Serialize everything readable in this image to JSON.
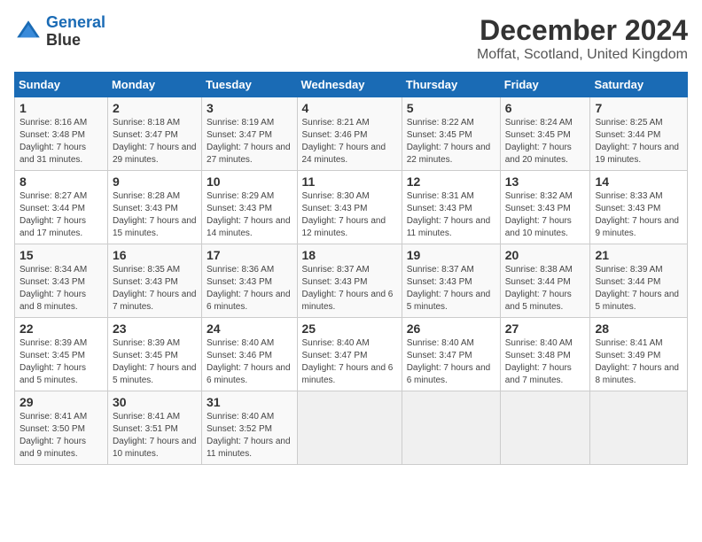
{
  "logo": {
    "line1": "General",
    "line2": "Blue"
  },
  "title": "December 2024",
  "subtitle": "Moffat, Scotland, United Kingdom",
  "accent_color": "#1a6bb5",
  "days_of_week": [
    "Sunday",
    "Monday",
    "Tuesday",
    "Wednesday",
    "Thursday",
    "Friday",
    "Saturday"
  ],
  "weeks": [
    [
      {
        "day": "1",
        "sunrise": "Sunrise: 8:16 AM",
        "sunset": "Sunset: 3:48 PM",
        "daylight": "Daylight: 7 hours and 31 minutes."
      },
      {
        "day": "2",
        "sunrise": "Sunrise: 8:18 AM",
        "sunset": "Sunset: 3:47 PM",
        "daylight": "Daylight: 7 hours and 29 minutes."
      },
      {
        "day": "3",
        "sunrise": "Sunrise: 8:19 AM",
        "sunset": "Sunset: 3:47 PM",
        "daylight": "Daylight: 7 hours and 27 minutes."
      },
      {
        "day": "4",
        "sunrise": "Sunrise: 8:21 AM",
        "sunset": "Sunset: 3:46 PM",
        "daylight": "Daylight: 7 hours and 24 minutes."
      },
      {
        "day": "5",
        "sunrise": "Sunrise: 8:22 AM",
        "sunset": "Sunset: 3:45 PM",
        "daylight": "Daylight: 7 hours and 22 minutes."
      },
      {
        "day": "6",
        "sunrise": "Sunrise: 8:24 AM",
        "sunset": "Sunset: 3:45 PM",
        "daylight": "Daylight: 7 hours and 20 minutes."
      },
      {
        "day": "7",
        "sunrise": "Sunrise: 8:25 AM",
        "sunset": "Sunset: 3:44 PM",
        "daylight": "Daylight: 7 hours and 19 minutes."
      }
    ],
    [
      {
        "day": "8",
        "sunrise": "Sunrise: 8:27 AM",
        "sunset": "Sunset: 3:44 PM",
        "daylight": "Daylight: 7 hours and 17 minutes."
      },
      {
        "day": "9",
        "sunrise": "Sunrise: 8:28 AM",
        "sunset": "Sunset: 3:43 PM",
        "daylight": "Daylight: 7 hours and 15 minutes."
      },
      {
        "day": "10",
        "sunrise": "Sunrise: 8:29 AM",
        "sunset": "Sunset: 3:43 PM",
        "daylight": "Daylight: 7 hours and 14 minutes."
      },
      {
        "day": "11",
        "sunrise": "Sunrise: 8:30 AM",
        "sunset": "Sunset: 3:43 PM",
        "daylight": "Daylight: 7 hours and 12 minutes."
      },
      {
        "day": "12",
        "sunrise": "Sunrise: 8:31 AM",
        "sunset": "Sunset: 3:43 PM",
        "daylight": "Daylight: 7 hours and 11 minutes."
      },
      {
        "day": "13",
        "sunrise": "Sunrise: 8:32 AM",
        "sunset": "Sunset: 3:43 PM",
        "daylight": "Daylight: 7 hours and 10 minutes."
      },
      {
        "day": "14",
        "sunrise": "Sunrise: 8:33 AM",
        "sunset": "Sunset: 3:43 PM",
        "daylight": "Daylight: 7 hours and 9 minutes."
      }
    ],
    [
      {
        "day": "15",
        "sunrise": "Sunrise: 8:34 AM",
        "sunset": "Sunset: 3:43 PM",
        "daylight": "Daylight: 7 hours and 8 minutes."
      },
      {
        "day": "16",
        "sunrise": "Sunrise: 8:35 AM",
        "sunset": "Sunset: 3:43 PM",
        "daylight": "Daylight: 7 hours and 7 minutes."
      },
      {
        "day": "17",
        "sunrise": "Sunrise: 8:36 AM",
        "sunset": "Sunset: 3:43 PM",
        "daylight": "Daylight: 7 hours and 6 minutes."
      },
      {
        "day": "18",
        "sunrise": "Sunrise: 8:37 AM",
        "sunset": "Sunset: 3:43 PM",
        "daylight": "Daylight: 7 hours and 6 minutes."
      },
      {
        "day": "19",
        "sunrise": "Sunrise: 8:37 AM",
        "sunset": "Sunset: 3:43 PM",
        "daylight": "Daylight: 7 hours and 5 minutes."
      },
      {
        "day": "20",
        "sunrise": "Sunrise: 8:38 AM",
        "sunset": "Sunset: 3:44 PM",
        "daylight": "Daylight: 7 hours and 5 minutes."
      },
      {
        "day": "21",
        "sunrise": "Sunrise: 8:39 AM",
        "sunset": "Sunset: 3:44 PM",
        "daylight": "Daylight: 7 hours and 5 minutes."
      }
    ],
    [
      {
        "day": "22",
        "sunrise": "Sunrise: 8:39 AM",
        "sunset": "Sunset: 3:45 PM",
        "daylight": "Daylight: 7 hours and 5 minutes."
      },
      {
        "day": "23",
        "sunrise": "Sunrise: 8:39 AM",
        "sunset": "Sunset: 3:45 PM",
        "daylight": "Daylight: 7 hours and 5 minutes."
      },
      {
        "day": "24",
        "sunrise": "Sunrise: 8:40 AM",
        "sunset": "Sunset: 3:46 PM",
        "daylight": "Daylight: 7 hours and 6 minutes."
      },
      {
        "day": "25",
        "sunrise": "Sunrise: 8:40 AM",
        "sunset": "Sunset: 3:47 PM",
        "daylight": "Daylight: 7 hours and 6 minutes."
      },
      {
        "day": "26",
        "sunrise": "Sunrise: 8:40 AM",
        "sunset": "Sunset: 3:47 PM",
        "daylight": "Daylight: 7 hours and 6 minutes."
      },
      {
        "day": "27",
        "sunrise": "Sunrise: 8:40 AM",
        "sunset": "Sunset: 3:48 PM",
        "daylight": "Daylight: 7 hours and 7 minutes."
      },
      {
        "day": "28",
        "sunrise": "Sunrise: 8:41 AM",
        "sunset": "Sunset: 3:49 PM",
        "daylight": "Daylight: 7 hours and 8 minutes."
      }
    ],
    [
      {
        "day": "29",
        "sunrise": "Sunrise: 8:41 AM",
        "sunset": "Sunset: 3:50 PM",
        "daylight": "Daylight: 7 hours and 9 minutes."
      },
      {
        "day": "30",
        "sunrise": "Sunrise: 8:41 AM",
        "sunset": "Sunset: 3:51 PM",
        "daylight": "Daylight: 7 hours and 10 minutes."
      },
      {
        "day": "31",
        "sunrise": "Sunrise: 8:40 AM",
        "sunset": "Sunset: 3:52 PM",
        "daylight": "Daylight: 7 hours and 11 minutes."
      },
      null,
      null,
      null,
      null
    ]
  ]
}
